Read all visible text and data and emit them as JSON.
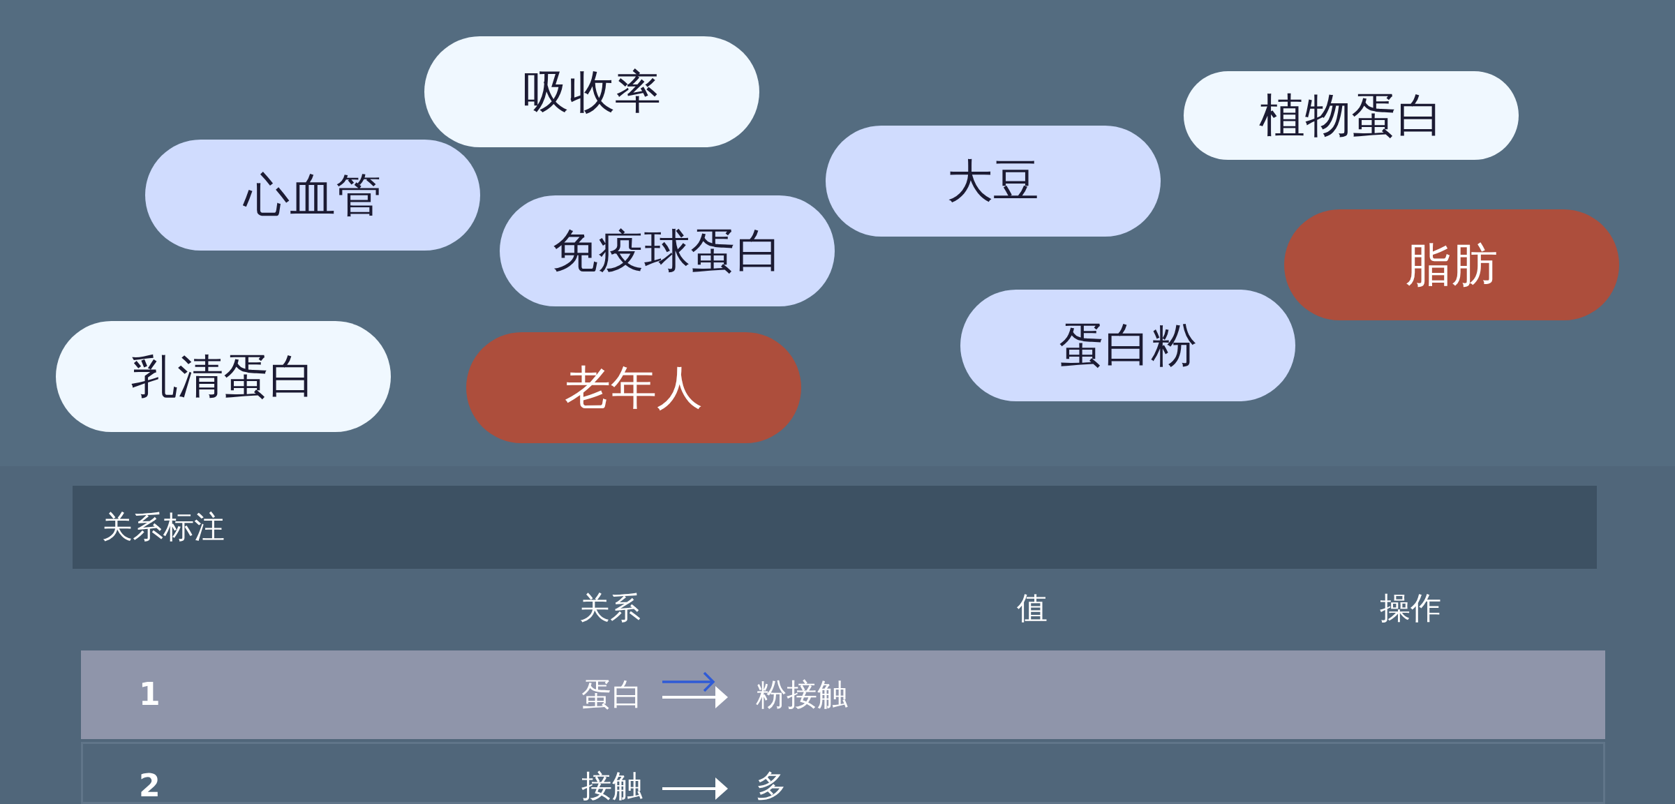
{
  "canvas": {
    "tags": [
      {
        "label": "吸收率",
        "color": "#f0f8ff"
      },
      {
        "label": "植物蛋白",
        "color": "#f0f8ff"
      },
      {
        "label": "大豆",
        "color": "#d0dcfe"
      },
      {
        "label": "心血管",
        "color": "#d0dcfe"
      },
      {
        "label": "免疫球蛋白",
        "color": "#d0dcfe"
      },
      {
        "label": "脂肪",
        "color": "#ad4e3c"
      },
      {
        "label": "蛋白粉",
        "color": "#d0dcfe"
      },
      {
        "label": "乳清蛋白",
        "color": "#f0f8ff"
      },
      {
        "label": "老年人",
        "color": "#ad4e3c"
      }
    ]
  },
  "panel": {
    "title": "关系标注",
    "columns": [
      "关系",
      "值",
      "操作"
    ],
    "rows": [
      {
        "index": "1",
        "source": "蛋白",
        "target": "粉接触",
        "selected": true
      },
      {
        "index": "2",
        "source": "接触",
        "target": "多",
        "selected": false
      }
    ]
  }
}
